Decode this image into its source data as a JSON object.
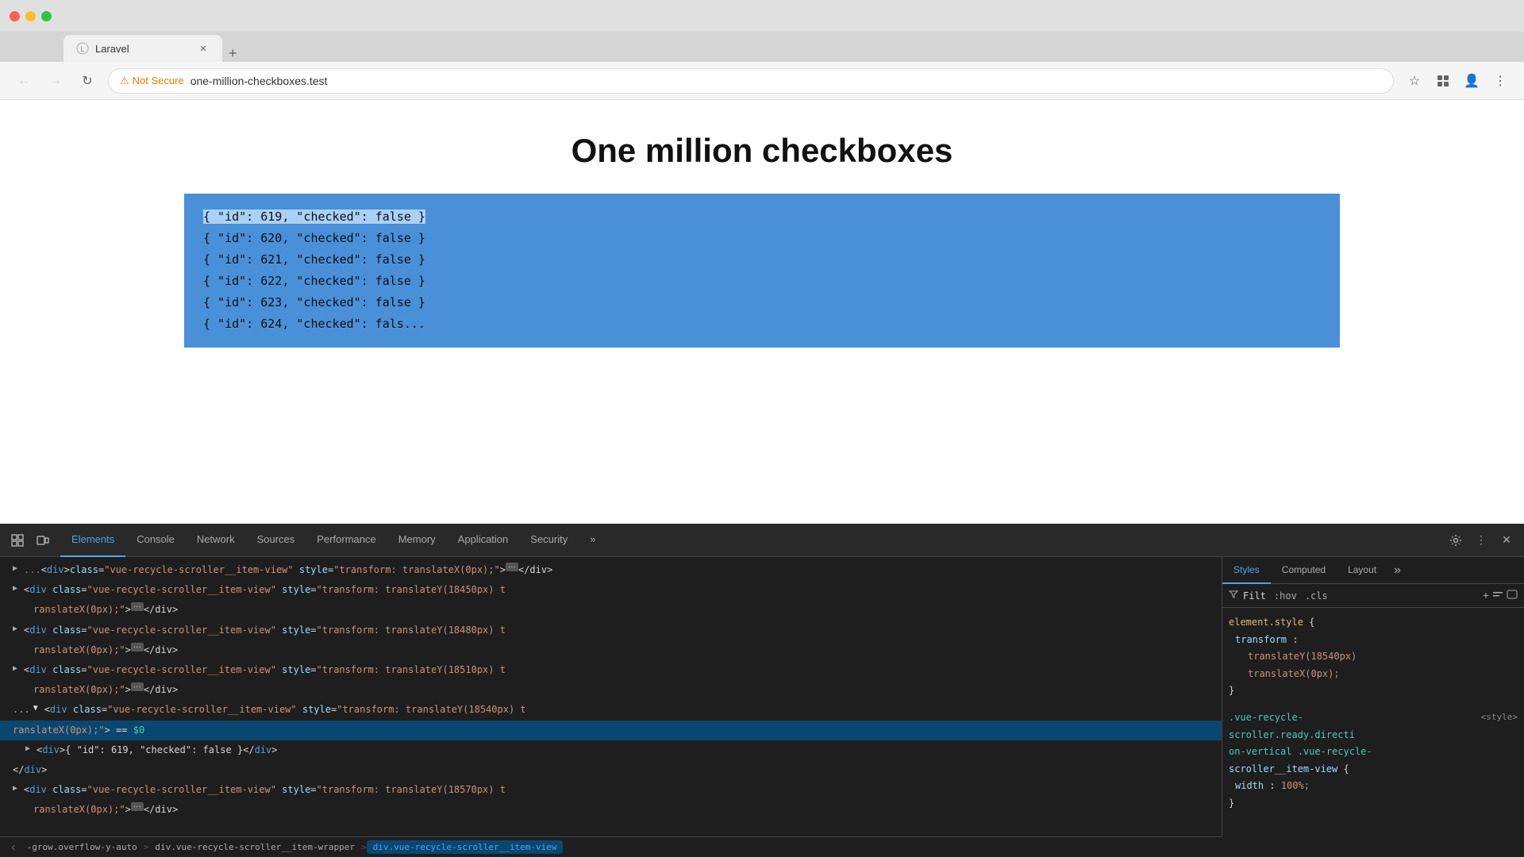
{
  "browser": {
    "tab_title": "Laravel",
    "url": "one-million-checkboxes.test",
    "not_secure_label": "Not Secure",
    "back_disabled": true,
    "forward_disabled": true
  },
  "page": {
    "title": "One million checkboxes",
    "checkbox_items": [
      {
        "id": "619",
        "checked": "false",
        "highlighted": true
      },
      {
        "id": "620",
        "checked": "false",
        "highlighted": false
      },
      {
        "id": "621",
        "checked": "false",
        "highlighted": false
      },
      {
        "id": "622",
        "checked": "false",
        "highlighted": false
      },
      {
        "id": "623",
        "checked": "false",
        "highlighted": false
      },
      {
        "id": "624",
        "checked": "false",
        "highlighted": false,
        "partial": true
      }
    ]
  },
  "devtools": {
    "tabs": [
      {
        "label": "Elements",
        "active": true
      },
      {
        "label": "Console",
        "active": false
      },
      {
        "label": "Network",
        "active": false
      },
      {
        "label": "Sources",
        "active": false
      },
      {
        "label": "Performance",
        "active": false
      },
      {
        "label": "Memory",
        "active": false
      },
      {
        "label": "Application",
        "active": false
      },
      {
        "label": "Security",
        "active": false
      },
      {
        "label": "»",
        "active": false
      }
    ],
    "elements": [
      {
        "id": "e1",
        "type": "collapsed",
        "indent": 0,
        "content": "translateX(0px);>···</div>",
        "selected": false
      },
      {
        "id": "e2",
        "type": "node",
        "indent": 0,
        "content": "<div class=\"vue-recycle-scroller__item-view\" style=\"transform: translateY(18450px) t",
        "selected": false,
        "continued": "ranslateX(0px);\">···</div>"
      },
      {
        "id": "e3",
        "type": "node",
        "indent": 0,
        "content": "<div class=\"vue-recycle-scroller__item-view\" style=\"transform: translateY(18480px) t",
        "selected": false,
        "continued": "ranslateX(0px);\">···</div>"
      },
      {
        "id": "e4",
        "type": "node",
        "indent": 0,
        "content": "<div class=\"vue-recycle-scroller__item-view\" style=\"transform: translateY(18510px) t",
        "selected": false,
        "continued": "ranslateX(0px);\">···</div>"
      },
      {
        "id": "e5",
        "type": "node_open",
        "indent": 0,
        "content": "<div class=\"vue-recycle-scroller__item-view\" style=\"transform: translateY(18540px) t",
        "selected": true,
        "continued": "ranslateX(0px);\"> == $0",
        "has_child": true
      },
      {
        "id": "e5c",
        "type": "child",
        "indent": 2,
        "content": "<div>{ \"id\": 619, \"checked\": false }</div>",
        "selected": false
      },
      {
        "id": "e5e",
        "type": "close",
        "indent": 1,
        "content": "</div>",
        "selected": false
      },
      {
        "id": "e6",
        "type": "node",
        "indent": 0,
        "content": "<div class=\"vue-recycle-scroller__item-view\" style=\"transform: translateY(18570px) t",
        "selected": false,
        "continued": "ranslateX(0px);\">···</div>"
      }
    ],
    "breadcrumbs": [
      {
        "label": "-grow.overflow-y-auto",
        "active": false
      },
      {
        "label": "div.vue-recycle-scroller__item-wrapper",
        "active": false
      },
      {
        "label": "div.vue-recycle-scroller__item-view",
        "active": true
      }
    ],
    "styles_tabs": [
      {
        "label": "Styles",
        "active": true
      },
      {
        "label": "Computed",
        "active": false
      },
      {
        "label": "Layout",
        "active": false
      }
    ],
    "styles": {
      "filter_placeholder": "Filt",
      "filter_hov": ":hov",
      "filter_cls": ".cls",
      "element_style_rule": {
        "selector": "element.style",
        "properties": [
          {
            "prop": "transform",
            "val": ""
          },
          {
            "prop": "",
            "val": "translateY(18540px)"
          },
          {
            "prop": "",
            "val": "translateX(0px);"
          }
        ]
      },
      "class_rule": {
        "selector": ".vue-recycle-scroller.ready.directi",
        "selector2": "on-vertical .vue-recycle-scroller__item-view",
        "source": "<style>",
        "properties": [
          {
            "prop": "width",
            "val": "100%;"
          }
        ]
      }
    }
  }
}
